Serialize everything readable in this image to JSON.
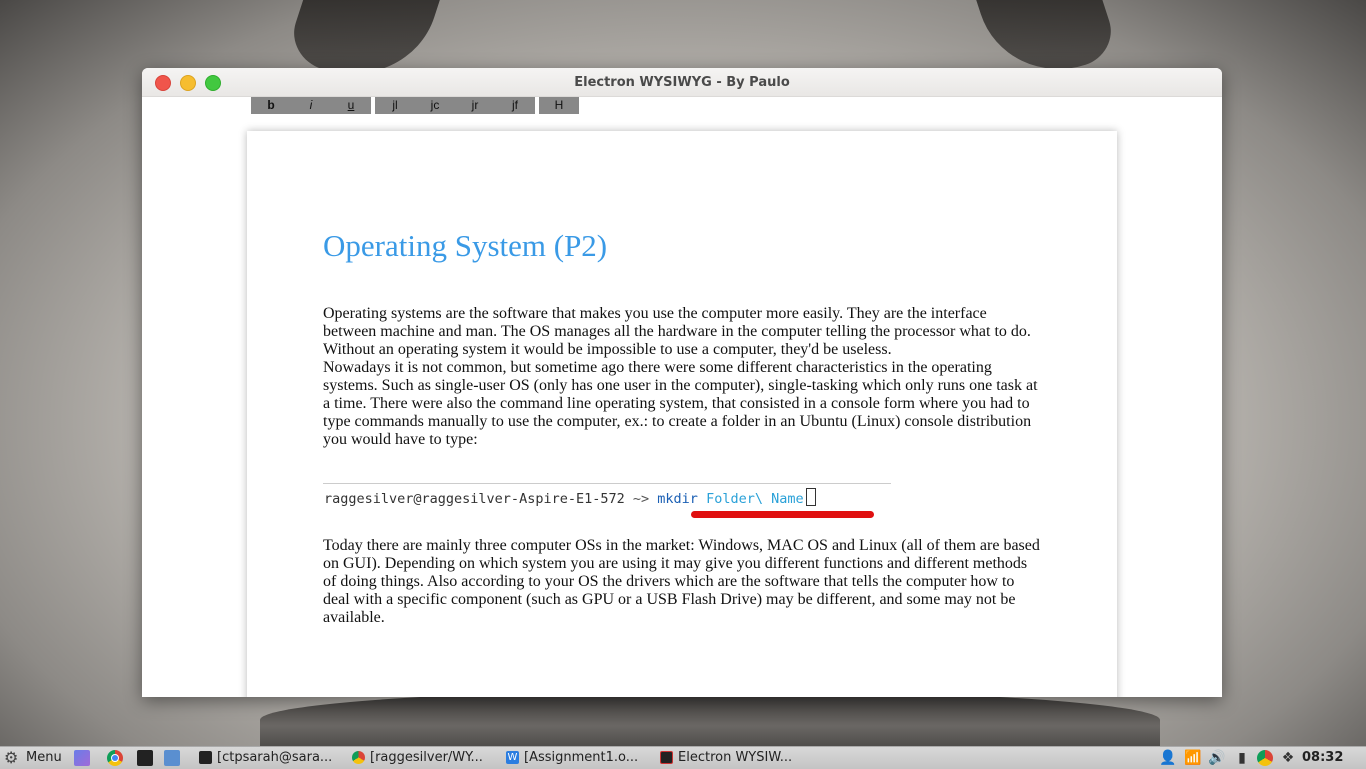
{
  "window": {
    "title": "Electron WYSIWYG - By Paulo"
  },
  "toolbar": {
    "groups": [
      [
        {
          "label": "b",
          "style": "bold"
        },
        {
          "label": "i",
          "style": "italic"
        },
        {
          "label": "u",
          "style": "underline"
        }
      ],
      [
        {
          "label": "jl"
        },
        {
          "label": "jc"
        },
        {
          "label": "jr"
        },
        {
          "label": "jf"
        }
      ],
      [
        {
          "label": "H"
        }
      ]
    ]
  },
  "document": {
    "title": "Operating System (P2)",
    "paragraph1": "Operating systems are the software that makes you use the computer more easily. They are the interface between machine and man. The OS manages all the hardware in the computer telling the processor what to do. Without an operating system it would be impossible to use a computer, they'd be useless.",
    "paragraph2": "Nowadays it is not common, but sometime ago there were some different characteristics in the operating systems. Such as single-user OS (only has one user in the computer), single-tasking which only runs one task at a time. There were also the command line operating system, that consisted in a console form where you had to type commands manually to use the computer, ex.: to create a folder in an Ubuntu (Linux) console distribution you would have to type:",
    "console": {
      "prompt": "raggesilver@raggesilver-Aspire-E1-572",
      "arrow": "~>",
      "command": "mkdir",
      "arguments": "Folder\\ Name"
    },
    "paragraph3": "Today there are mainly three computer OSs in the market: Windows, MAC OS and Linux (all of them are based on GUI). Depending on which system you are using it may give you different functions and different methods of doing things. Also according to your OS the drivers which are the software that tells the computer how to deal with a specific component (such as GPU or a USB Flash Drive) may be different, and some may not be available."
  },
  "taskbar": {
    "menu_label": "Menu",
    "tasks": [
      {
        "label": "[ctpsarah@sara...",
        "icon": "terminal-icon"
      },
      {
        "label": "[raggesilver/WY...",
        "icon": "chrome-icon"
      },
      {
        "label": "[Assignment1.o...",
        "icon": "writer-icon"
      },
      {
        "label": "Electron WYSIW...",
        "icon": "electron-icon"
      }
    ],
    "clock": "08:32"
  },
  "colors": {
    "title_blue": "#3a9ae6",
    "underline_red": "#e01010",
    "toolbar_gray": "#888888"
  }
}
